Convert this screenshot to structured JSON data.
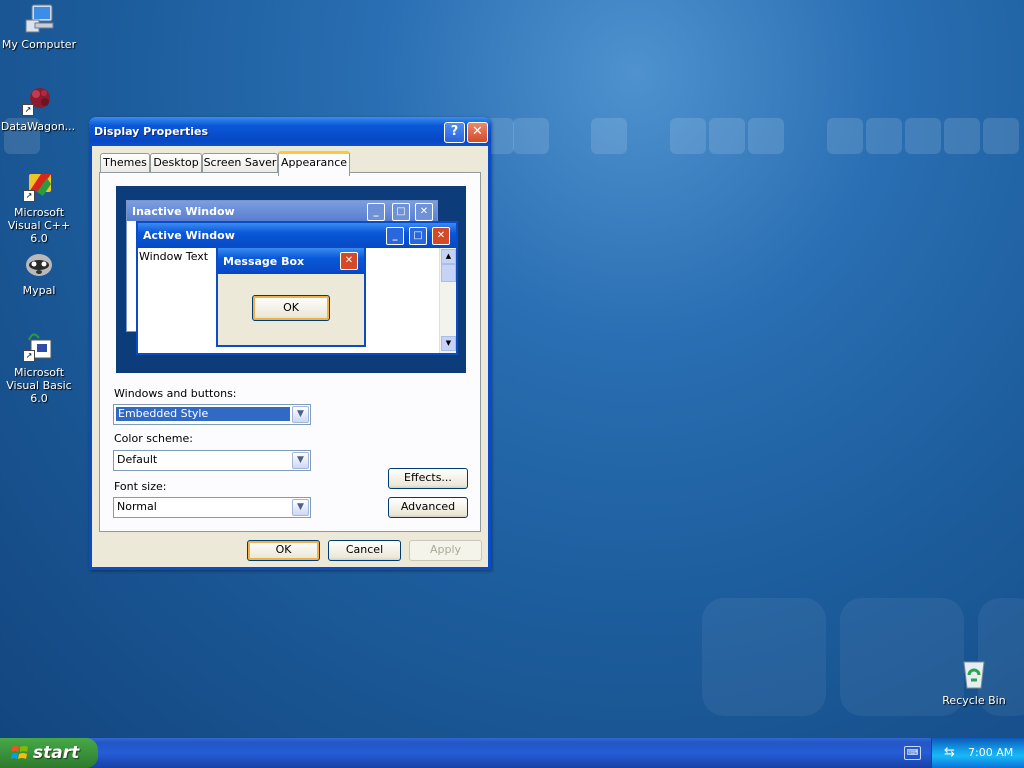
{
  "desktop": {
    "icons": [
      {
        "label": "My Computer"
      },
      {
        "label": "DataWagon..."
      },
      {
        "label": "Microsoft Visual C++ 6.0"
      },
      {
        "label": "Mypal"
      },
      {
        "label": "Microsoft Visual Basic 6.0"
      },
      {
        "label": "Recycle Bin"
      }
    ]
  },
  "dialog": {
    "title": "Display Properties",
    "help_label": "?",
    "close_label": "✕",
    "tabs": [
      {
        "label": "Themes"
      },
      {
        "label": "Desktop"
      },
      {
        "label": "Screen Saver"
      },
      {
        "label": "Appearance"
      }
    ],
    "preview": {
      "inactive_title": "Inactive Window",
      "active_title": "Active Window",
      "window_text": "Window Text",
      "message_box_title": "Message Box",
      "ok_label": "OK"
    },
    "windows_buttons": {
      "label": "Windows and buttons:",
      "value": "Embedded Style"
    },
    "color_scheme": {
      "label": "Color scheme:",
      "value": "Default"
    },
    "font_size": {
      "label": "Font size:",
      "value": "Normal"
    },
    "effects_label": "Effects...",
    "advanced_label": "Advanced",
    "ok_label": "OK",
    "cancel_label": "Cancel",
    "apply_label": "Apply"
  },
  "taskbar": {
    "start_label": "start",
    "clock": "7:00 AM"
  },
  "colors": {
    "accent": "#0a58d8",
    "start_green": "#3b923b",
    "default_button_ring": "#f0b04a"
  }
}
